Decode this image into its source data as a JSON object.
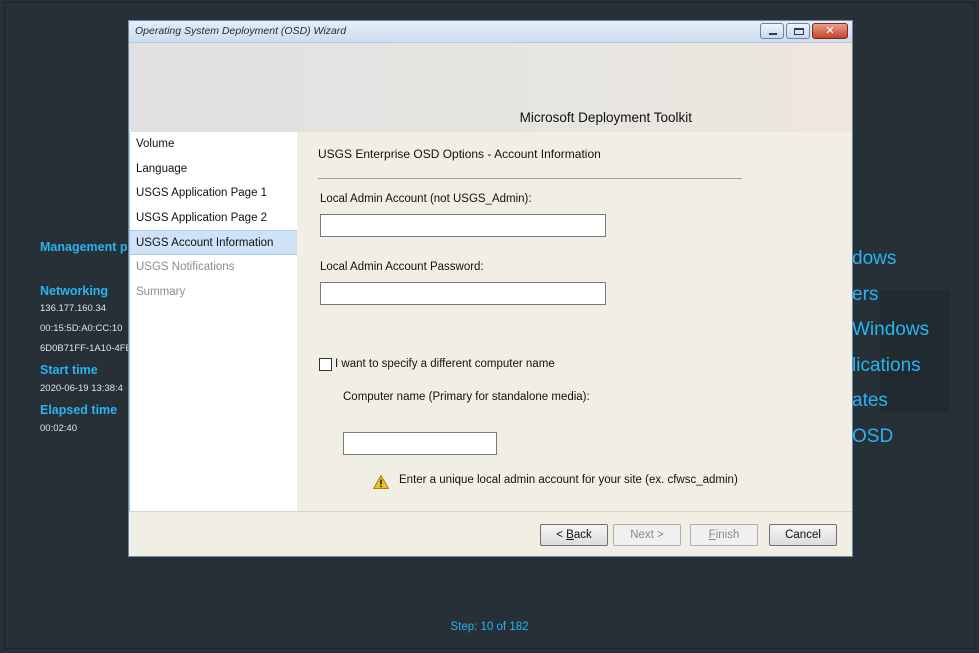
{
  "background": {
    "left_panel": [
      {
        "heading": "Management p"
      },
      {
        "heading": "Networking",
        "values": [
          "136.177.160.34",
          "00:15:5D:A0:CC:10",
          "6D0B71FF-1A10-4FE"
        ]
      },
      {
        "heading": "Start time",
        "values": [
          "2020-06-19 13:38:4"
        ]
      },
      {
        "heading": "Elapsed time",
        "values": [
          "00:02:40"
        ]
      }
    ],
    "right_panel": [
      "dows",
      "ers",
      "Windows",
      "lications",
      "ates",
      "OSD"
    ],
    "step": {
      "label": "Step:",
      "current": "10",
      "of_label": "of",
      "total": "182"
    },
    "accent_color": "#27b4f0"
  },
  "window": {
    "title": "Operating System Deployment (OSD) Wizard",
    "banner_title": "Microsoft Deployment Toolkit",
    "close_glyph": "✕",
    "nav_items": [
      {
        "label": "Volume",
        "state": "normal"
      },
      {
        "label": "Language",
        "state": "normal"
      },
      {
        "label": "USGS Application Page 1",
        "state": "normal"
      },
      {
        "label": "USGS Application Page 2",
        "state": "normal"
      },
      {
        "label": "USGS Account Information",
        "state": "active"
      },
      {
        "label": "USGS Notifications",
        "state": "disabled"
      },
      {
        "label": "Summary",
        "state": "disabled"
      }
    ],
    "content": {
      "heading": "USGS Enterprise OSD Options -  Account Information",
      "admin_account_label": "Local Admin Account (not USGS_Admin):",
      "admin_account_value": "",
      "admin_password_label": "Local Admin Account Password:",
      "admin_password_value": "",
      "different_name_checkbox_label": "I want to specify a different computer name",
      "different_name_checked": false,
      "computer_name_label": "Computer name (Primary for standalone media):",
      "computer_name_value": "",
      "warning_text": "Enter a unique local admin account for your site (ex. cfwsc_admin)"
    },
    "footer": {
      "back": {
        "prefix": "< ",
        "mnemonic": "B",
        "rest": "ack"
      },
      "next": "Next >",
      "finish": {
        "mnemonic": "F",
        "rest": "inish"
      },
      "cancel": "Cancel"
    }
  }
}
